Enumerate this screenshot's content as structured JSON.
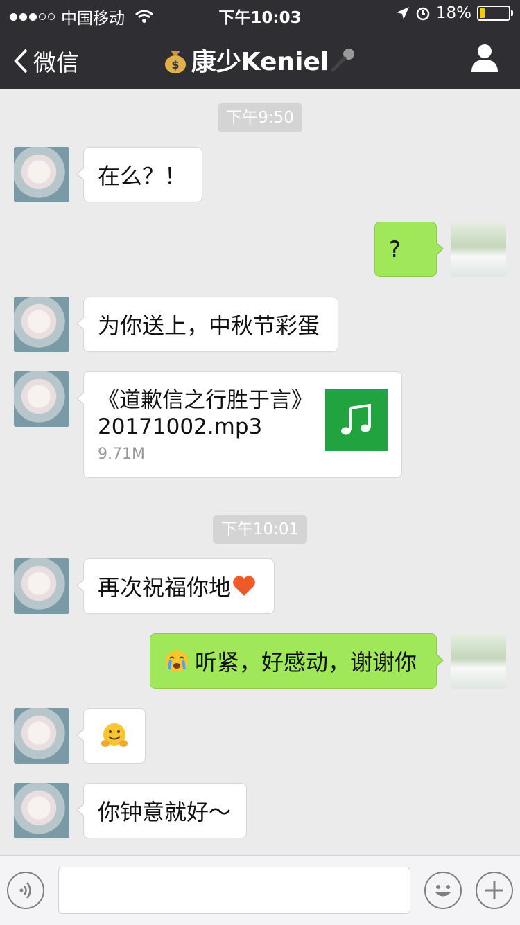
{
  "status_bar": {
    "carrier": "中国移动",
    "time": "下午10:03",
    "battery": "18%",
    "battery_level": 0.18
  },
  "nav": {
    "back_label": "微信",
    "title": "康少Keniel",
    "icons": [
      "chevron-left-icon",
      "money-bag-icon",
      "microphone-icon",
      "profile-icon"
    ]
  },
  "messages": {
    "ts1": "下午9:50",
    "m1": "在么？！",
    "m2": "?",
    "m3": "为你送上，中秋节彩蛋",
    "file": {
      "name": "《道歉信之行胜于言》20171002.mp3",
      "size": "9.71M",
      "icon": "music-note-icon"
    },
    "ts2": "下午10:01",
    "m5": "再次祝福你地",
    "m6": "听紧，好感动，谢谢你",
    "m7_emoji": "hugging-face-emoji",
    "m8": "你钟意就好～"
  },
  "input_bar": {
    "text_value": "",
    "icons": [
      "voice-icon",
      "emoji-icon",
      "plus-icon"
    ]
  },
  "colors": {
    "nav_bg": "#2e2e33",
    "chat_bg": "#ebebeb",
    "green_bubble": "#a0e75a",
    "music_icon_bg": "#21a33f"
  }
}
